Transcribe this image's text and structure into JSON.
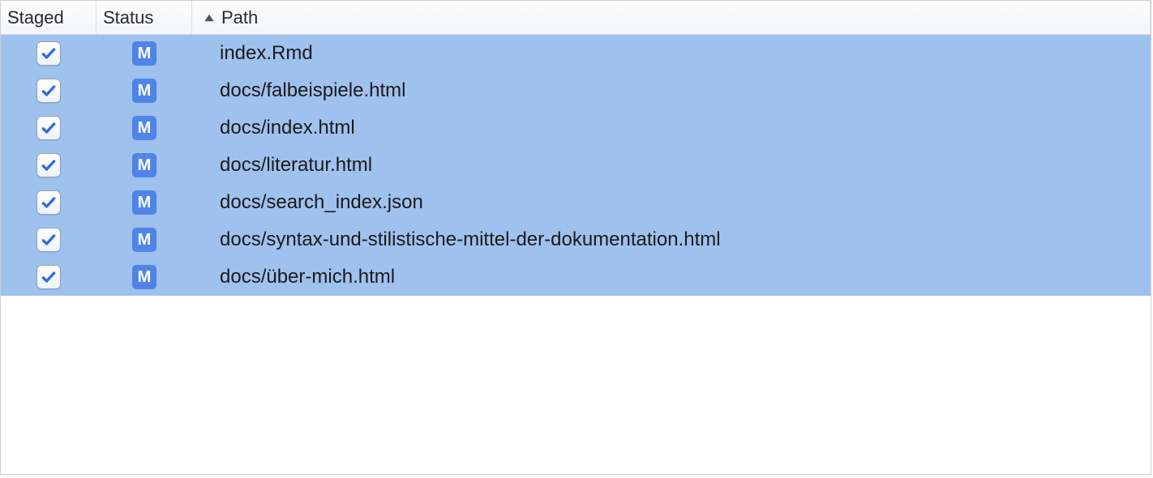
{
  "columns": {
    "staged": "Staged",
    "status": "Status",
    "path": "Path"
  },
  "sort": {
    "column": "path",
    "direction": "asc"
  },
  "status_letter": "M",
  "colors": {
    "selection": "#9fc1ee",
    "badge": "#4f84e8",
    "check": "#2b6edb"
  },
  "files": [
    {
      "staged": true,
      "status": "M",
      "path": "index.Rmd"
    },
    {
      "staged": true,
      "status": "M",
      "path": "docs/falbeispiele.html"
    },
    {
      "staged": true,
      "status": "M",
      "path": "docs/index.html"
    },
    {
      "staged": true,
      "status": "M",
      "path": "docs/literatur.html"
    },
    {
      "staged": true,
      "status": "M",
      "path": "docs/search_index.json"
    },
    {
      "staged": true,
      "status": "M",
      "path": "docs/syntax-und-stilistische-mittel-der-dokumentation.html"
    },
    {
      "staged": true,
      "status": "M",
      "path": "docs/über-mich.html"
    }
  ]
}
